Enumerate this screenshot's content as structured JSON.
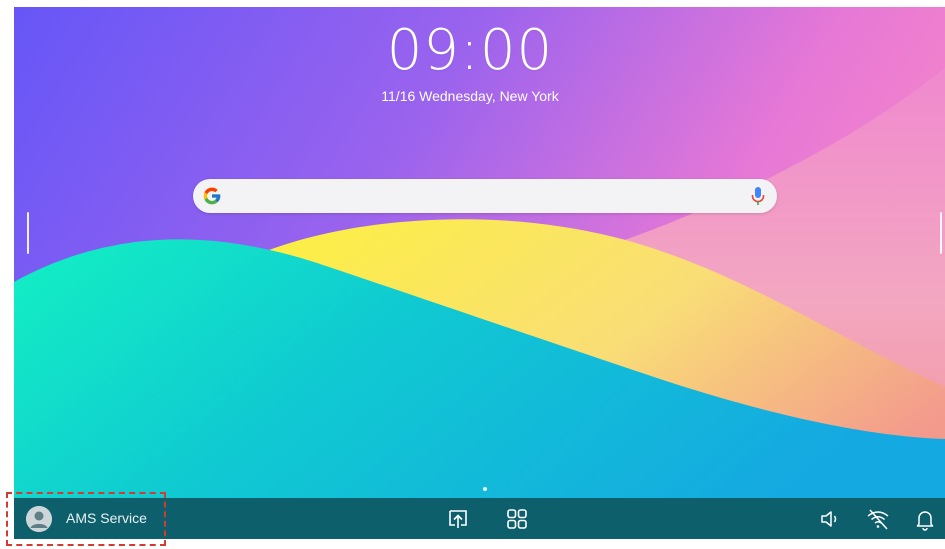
{
  "lockscreen": {
    "time": "09:00",
    "date": "11/16 Wednesday, New York"
  },
  "search": {
    "placeholder": "",
    "left_icon": "google-g-icon",
    "right_icon": "microphone-icon"
  },
  "taskbar": {
    "user_label": "AMS Service",
    "user_icon": "user-avatar-icon",
    "center_icons": [
      "screen-share-icon",
      "apps-grid-icon"
    ],
    "right_icons": [
      "volume-icon",
      "wifi-off-icon",
      "notification-bell-icon"
    ]
  },
  "highlight": {
    "target": "user-account-area",
    "color": "#d43a2f"
  },
  "colors": {
    "taskbar": "#0d5f6c",
    "wallpaper_top": "#6a5cf6",
    "wallpaper_pink": "#f07ac9",
    "wallpaper_yellow": "#f8ea4d",
    "wallpaper_teal": "#18e3c6",
    "wallpaper_blue": "#14a9e0"
  }
}
